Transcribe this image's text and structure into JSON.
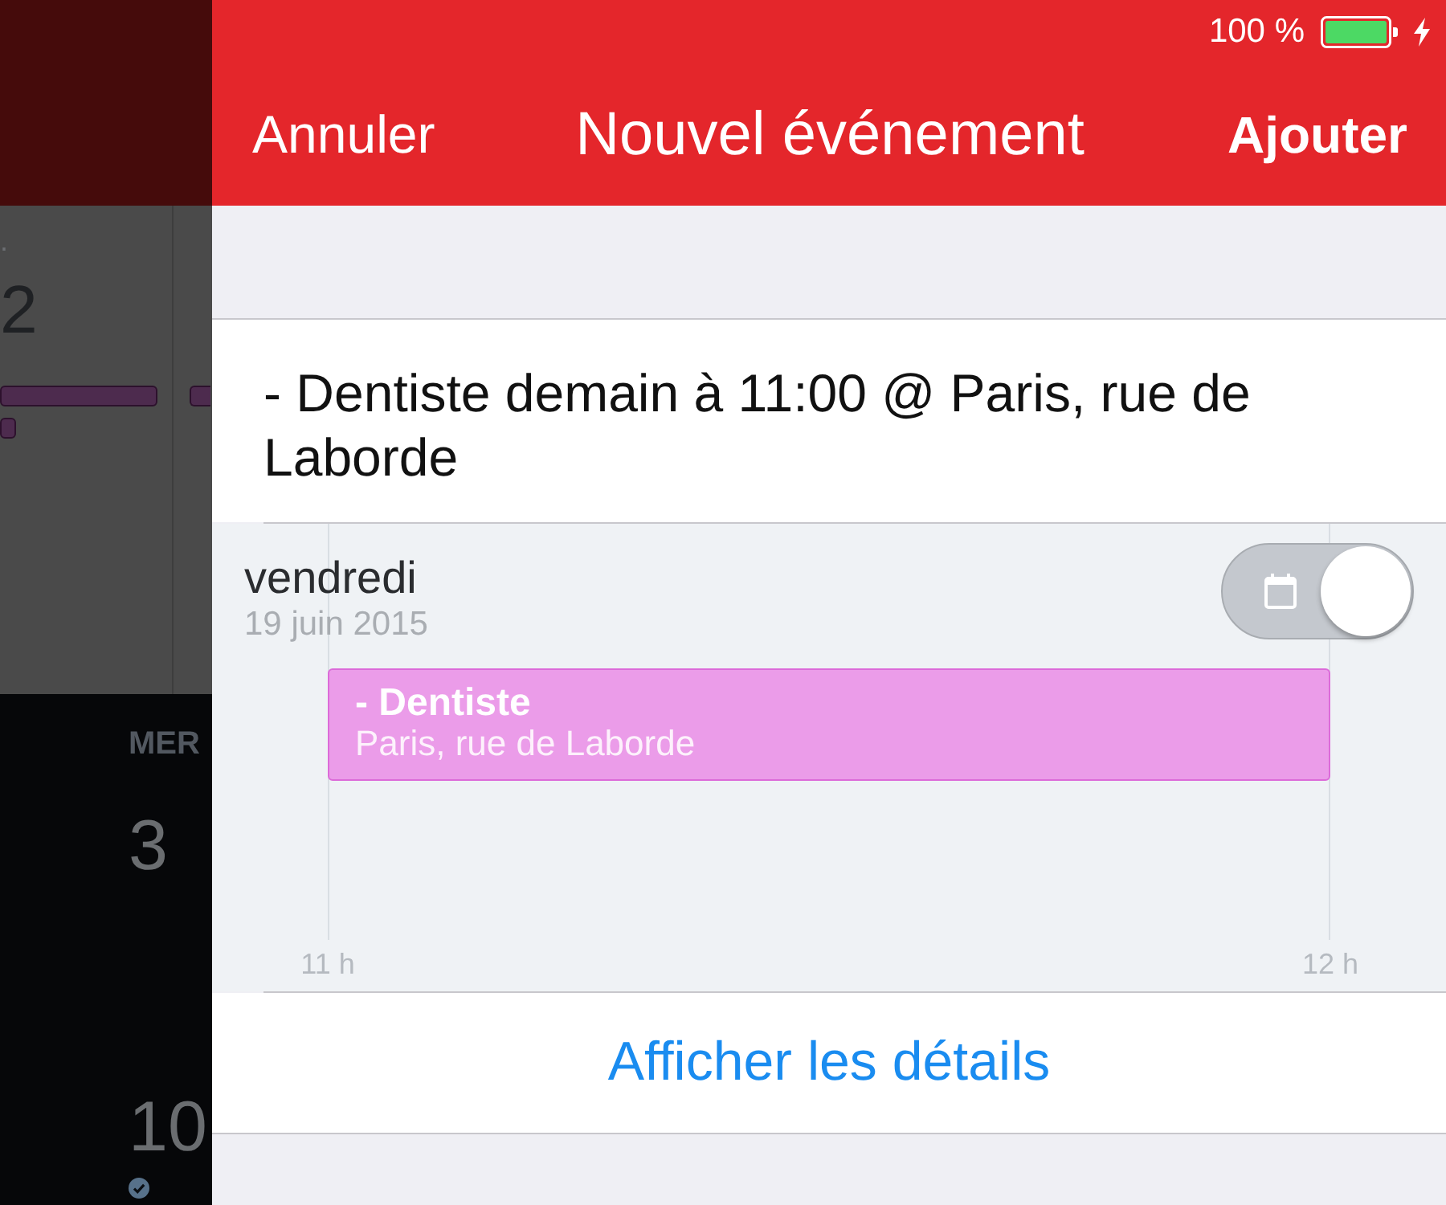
{
  "background_calendar": {
    "column_1": {
      "heading": ".",
      "day": "2"
    },
    "column_2": {
      "heading": "MER",
      "days": [
        "3",
        "10"
      ]
    }
  },
  "status_bar": {
    "battery_text": "100 %",
    "charging": true
  },
  "nav_bar": {
    "cancel": "Annuler",
    "title": "Nouvel événement",
    "add": "Ajouter"
  },
  "event_input": {
    "value": "- Dentiste demain à 11:00 @ Paris, rue de Laborde"
  },
  "preview": {
    "weekday": "vendredi",
    "date": "19 juin 2015",
    "calendar_toggle": {
      "on": true
    },
    "event": {
      "title": "- Dentiste",
      "location": "Paris, rue de Laborde"
    },
    "hours": [
      "11 h",
      "12 h"
    ]
  },
  "details_button": "Afficher les détails"
}
